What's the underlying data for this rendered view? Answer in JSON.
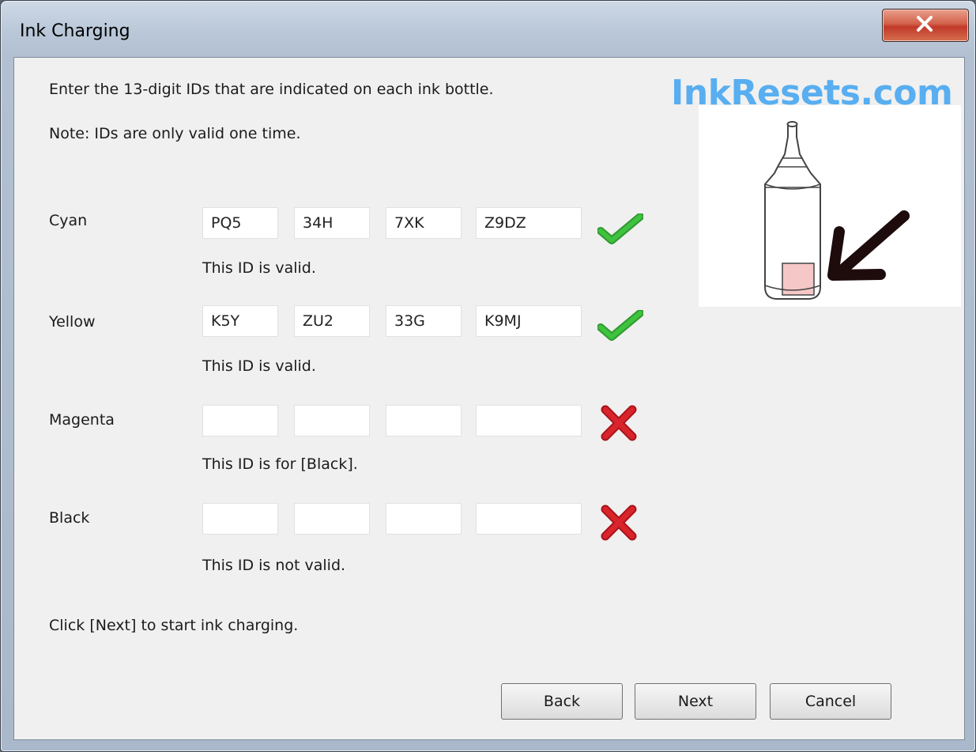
{
  "window": {
    "title": "Ink Charging"
  },
  "watermark": "InkResets.com",
  "instructions": {
    "line1": "Enter the 13-digit IDs that are indicated on each ink bottle.",
    "line2": "Note: IDs are only valid one time.",
    "footer": "Click [Next] to start ink charging."
  },
  "rows": [
    {
      "label": "Cyan",
      "fields": [
        "PQ5",
        "34H",
        "7XK",
        "Z9DZ"
      ],
      "status": "valid",
      "message": "This ID is valid."
    },
    {
      "label": "Yellow",
      "fields": [
        "K5Y",
        "ZU2",
        "33G",
        "K9MJ"
      ],
      "status": "valid",
      "message": "This ID is valid."
    },
    {
      "label": "Magenta",
      "fields": [
        "",
        "",
        "",
        ""
      ],
      "status": "invalid",
      "message": "This ID is for [Black]."
    },
    {
      "label": "Black",
      "fields": [
        "",
        "",
        "",
        ""
      ],
      "status": "invalid",
      "message": "This ID is not valid."
    }
  ],
  "buttons": {
    "back": "Back",
    "next": "Next",
    "cancel": "Cancel"
  },
  "icons": {
    "valid": "check-icon",
    "invalid": "cross-icon",
    "close": "close-icon",
    "bottle": "ink-bottle-illustration"
  },
  "colors": {
    "check": "#3fc23f",
    "cross": "#d8242a",
    "watermark": "#58aef0"
  }
}
